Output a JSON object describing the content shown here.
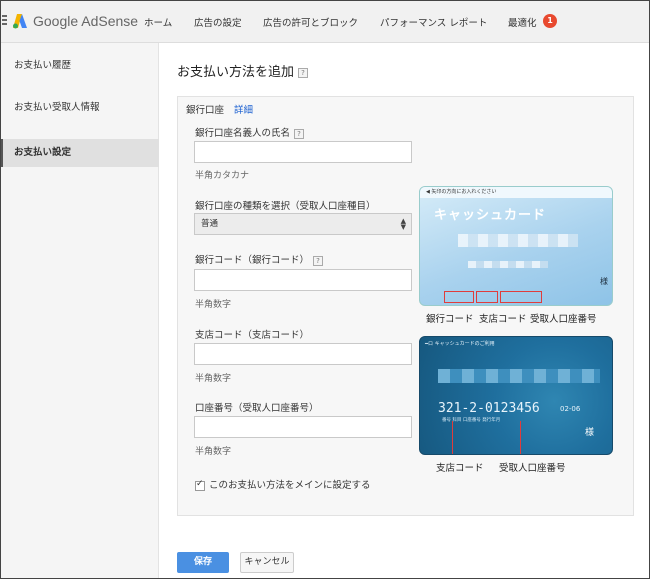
{
  "header": {
    "brand": "Google AdSense",
    "nav": [
      "ホーム",
      "広告の設定",
      "広告の許可とブロック",
      "パフォーマンス レポート",
      "最適化"
    ],
    "badge_count": "1"
  },
  "sidebar": {
    "items": [
      {
        "label": "お支払い履歴"
      },
      {
        "label": "お支払い受取人情報"
      },
      {
        "label": "お支払い設定"
      }
    ]
  },
  "main": {
    "title": "お支払い方法を追加",
    "help_glyph": "?",
    "tab_label": "銀行口座",
    "tab_link": "詳細",
    "account_name_label": "銀行口座名義人の氏名",
    "account_name_hint": "半角カタカナ",
    "account_type_label": "銀行口座の種類を選択（受取人口座種目）",
    "account_type_value": "普通",
    "bank_code_label": "銀行コード（銀行コード）",
    "bank_code_hint": "半角数字",
    "branch_code_label": "支店コード（支店コード）",
    "branch_code_hint": "半角数字",
    "account_number_label": "口座番号（受取人口座番号）",
    "account_number_hint": "半角数字",
    "primary_checkbox_label": "このお支払い方法をメインに設定する",
    "primary_checked": true
  },
  "card_front": {
    "ribbon_text": "◀ 矢印の方向にお入れください",
    "brand": "キャッシュカード",
    "honorific": "様",
    "captions": [
      "銀行コード",
      "支店コード",
      "受取人口座番号"
    ]
  },
  "card_back": {
    "ribbon_text": "━ロ キャッシュカードのご利用",
    "numbers": "321-2-0123456",
    "date": "02-06",
    "small_labels": "番号      科目       口座番号              発行年月",
    "honorific": "様",
    "captions": [
      "支店コード",
      "受取人口座番号"
    ]
  },
  "footer": {
    "save_label": "保存",
    "cancel_label": "キャンセル"
  },
  "colors": {
    "primary_button": "#4a90e2",
    "badge": "#e8492f",
    "link": "#1a5fd0",
    "highlight_box": "#e03c3c"
  }
}
